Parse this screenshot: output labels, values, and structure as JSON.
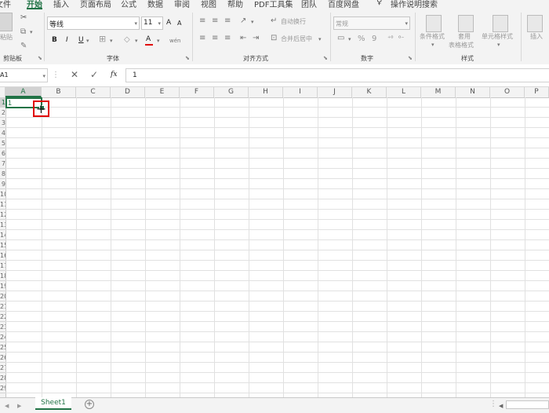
{
  "menu": {
    "items": [
      "文件",
      "开始",
      "插入",
      "页面布局",
      "公式",
      "数据",
      "审阅",
      "视图",
      "帮助",
      "PDF工具集",
      "团队",
      "百度网盘"
    ],
    "tell_me": "操作说明搜索"
  },
  "ribbon": {
    "clipboard": {
      "paste": "粘贴",
      "label": "剪贴板"
    },
    "font": {
      "name": "等线",
      "size": "11",
      "bold": "B",
      "italic": "I",
      "underline": "U",
      "label": "字体",
      "grow": "A",
      "shrink": "A",
      "font_color": "A"
    },
    "alignment": {
      "wrap": "自动换行",
      "merge": "合并后居中",
      "label": "对齐方式"
    },
    "number": {
      "format": "常规",
      "percent": "%",
      "comma": "9",
      "label": "数字"
    },
    "styles": {
      "conditional": "条件格式",
      "table_l1": "套用",
      "table_l2": "表格格式",
      "cell": "单元格样式",
      "label": "样式"
    },
    "cells": {
      "insert": "插入"
    }
  },
  "formula_bar": {
    "name_box": "A1",
    "fx": "fx",
    "value": "1"
  },
  "grid": {
    "columns": [
      "A",
      "B",
      "C",
      "D",
      "E",
      "F",
      "G",
      "H",
      "I",
      "J",
      "K",
      "L",
      "M",
      "N",
      "O",
      "P"
    ],
    "rows": [
      "1",
      "2",
      "3",
      "4",
      "5",
      "6",
      "7",
      "8",
      "9",
      "10",
      "11",
      "12",
      "13",
      "14",
      "15",
      "16",
      "17",
      "18",
      "19",
      "20",
      "21",
      "22",
      "23",
      "24",
      "25",
      "26",
      "27",
      "28",
      "29"
    ],
    "a1_value": "1"
  },
  "sheets": {
    "tabs": [
      "Sheet1"
    ],
    "add": "+"
  },
  "colors": {
    "accent": "#217346",
    "highlight": "#e00000"
  }
}
